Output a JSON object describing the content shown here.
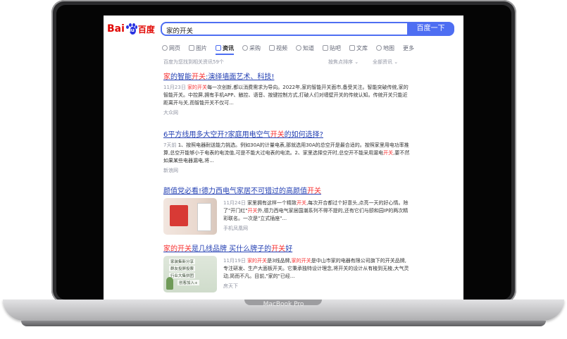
{
  "device": {
    "brand": "MacBook Pro"
  },
  "header": {
    "logo_left": "Bai",
    "logo_paw": "du",
    "logo_right": "百度",
    "query": "家的开关",
    "search_button": "百度一下"
  },
  "tabs": [
    "网页",
    "图片",
    "资讯",
    "采购",
    "视频",
    "知道",
    "贴吧",
    "文库",
    "地图",
    "更多"
  ],
  "toolbar": {
    "result_count": "百度为您找到相关资讯59个",
    "sort": "按焦点排序",
    "filter": "全部资讯"
  },
  "results": [
    {
      "title_hl1": "家",
      "title_mid1": "的智能",
      "title_hl2": "开关",
      "title_rest": ":演绎墙面艺术、科技!",
      "date": "11月23日",
      "abs_hl1": "家的开关",
      "abs_rest": "每一次创新,都以消费需求为导向。2022年,家的智能开关面市,备受关注。智能突破传统,家的智能开关。中控屏,拥有手机APP、触控、语音、按键控制方式,打破人们对墙壁开关的传统认知。传统开关只能近距离开与关,而智能开关不仅可...",
      "source": "大众网"
    },
    {
      "title_pre": "6平方线用多大空开?家庭用电空气",
      "title_hl": "开关",
      "title_rest": "的如何选择?",
      "date": "7天前",
      "abs_pre": "1、按照电器耐送能力挑选。例如30A的计量电表,那就选用30A的总空开是最合适的。按照家里用电功率推算,总空开能够小于电表的电流值,可是不能大过电表的电流。2、家里选择空开时,总空开不能采用漏电",
      "abs_hl": "开关",
      "abs_rest": ",要不然如果某些电器漏电,将...",
      "source": "新浪网"
    },
    {
      "title_pre": "颜值党必看!德力西电气家居不可错过的高颜值",
      "title_hl": "开关",
      "date": "11月24日",
      "abs_pre": "家里拥有这样一个精致",
      "abs_hl1": "开关",
      "abs_mid": ",每次开合都过个好意头,点亮一天的好心情。除了\"开门红\"",
      "abs_hl2": "开关",
      "abs_rest": "外,德力西电气家居国潮系列不得不提的,还有它们与颐和园IP的两次精彩联名。一次是\"立式插座\"...",
      "source": "手机凤凰网"
    },
    {
      "title_hl1": "家的开关",
      "title_mid": "是几线品牌 买什么牌子的",
      "title_hl2": "开关",
      "title_rest": "好",
      "date": "11月19日",
      "abs_pre": "",
      "abs_hl1": "家的开关",
      "abs_mid": "是3线品牌,",
      "abs_hl2": "家的开关",
      "abs_rest": "是中山市家的电器有限公司旗下的开关品牌,专注研发、生产大面板开关。它秉承独特设计理念,将开关的设计从有棱到无棱,大气灵动,简而不凡。目前,\"家的\"已经...",
      "source": "房天下",
      "thumb_lines": [
        "家装集新分享",
        "群友投屏投票",
        "行业大集拼团",
        "创客加入+"
      ]
    }
  ]
}
